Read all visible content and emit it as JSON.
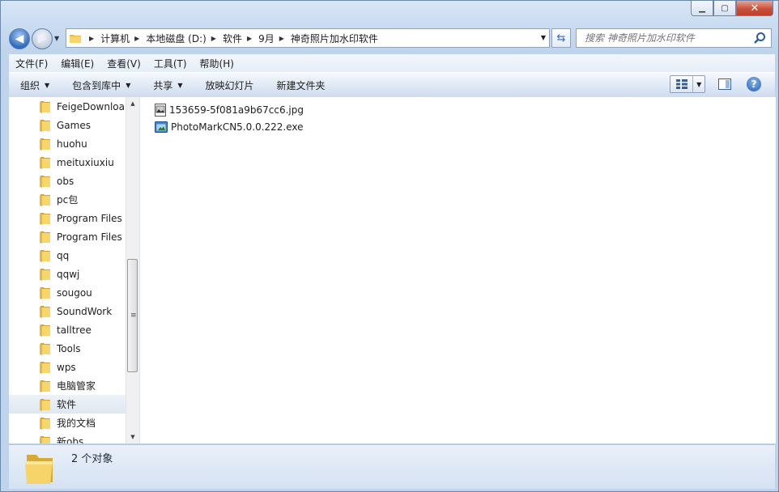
{
  "window": {
    "minimize": "▁",
    "maximize": "▢",
    "close": "✕"
  },
  "address": {
    "crumbs": [
      "计算机",
      "本地磁盘 (D:)",
      "软件",
      "9月",
      "神奇照片加水印软件"
    ]
  },
  "search": {
    "placeholder": "搜索 神奇照片加水印软件"
  },
  "menu": [
    "文件(F)",
    "编辑(E)",
    "查看(V)",
    "工具(T)",
    "帮助(H)"
  ],
  "toolbar": {
    "organize": "组织",
    "include_library": "包含到库中",
    "share": "共享",
    "slideshow": "放映幻灯片",
    "new_folder": "新建文件夹"
  },
  "nav_items": [
    "FeigeDownloa",
    "Games",
    "huohu",
    "meituxiuxiu",
    "obs",
    "pc包",
    "Program Files",
    "Program Files",
    "qq",
    "qqwj",
    "sougou",
    "SoundWork",
    "talltree",
    "Tools",
    "wps",
    "电脑管家",
    "软件",
    "我的文档",
    "新obs"
  ],
  "selected_nav": "软件",
  "files": [
    {
      "name": "153659-5f081a9b67cc6.jpg",
      "icon": "image-file-icon"
    },
    {
      "name": "PhotoMarkCN5.0.0.222.exe",
      "icon": "exe-file-icon"
    }
  ],
  "status": {
    "text": "2 个对象"
  },
  "colors": {
    "accent": "#2f6cc0",
    "folder": "#f2c94c"
  }
}
